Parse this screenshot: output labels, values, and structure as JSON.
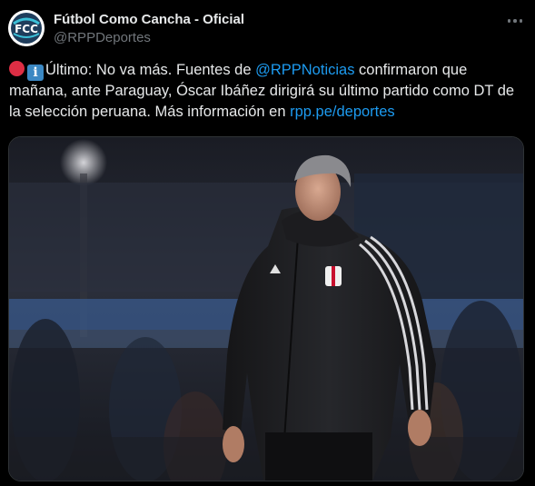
{
  "account": {
    "name": "Fútbol Como Cancha - Oficial",
    "handle": "@RPPDeportes",
    "avatar_text": "FCC"
  },
  "tweet": {
    "emoji_1": "red-circle-icon",
    "emoji_2": "information-icon",
    "info_glyph": "i",
    "text_part1": "Último: No va más. Fuentes de ",
    "mention": "@RPPNoticias",
    "text_part2": " confirmaron que mañana, ante Paraguay, Óscar Ibáñez dirigirá su último partido como DT de la selección peruana. Más información en ",
    "link": "rpp.pe/deportes"
  },
  "photo": {
    "subject": "coach-in-black-jacket-photo"
  },
  "colors": {
    "background": "#000000",
    "text": "#e7e9ea",
    "secondary": "#71767b",
    "link": "#1d9bf0"
  }
}
